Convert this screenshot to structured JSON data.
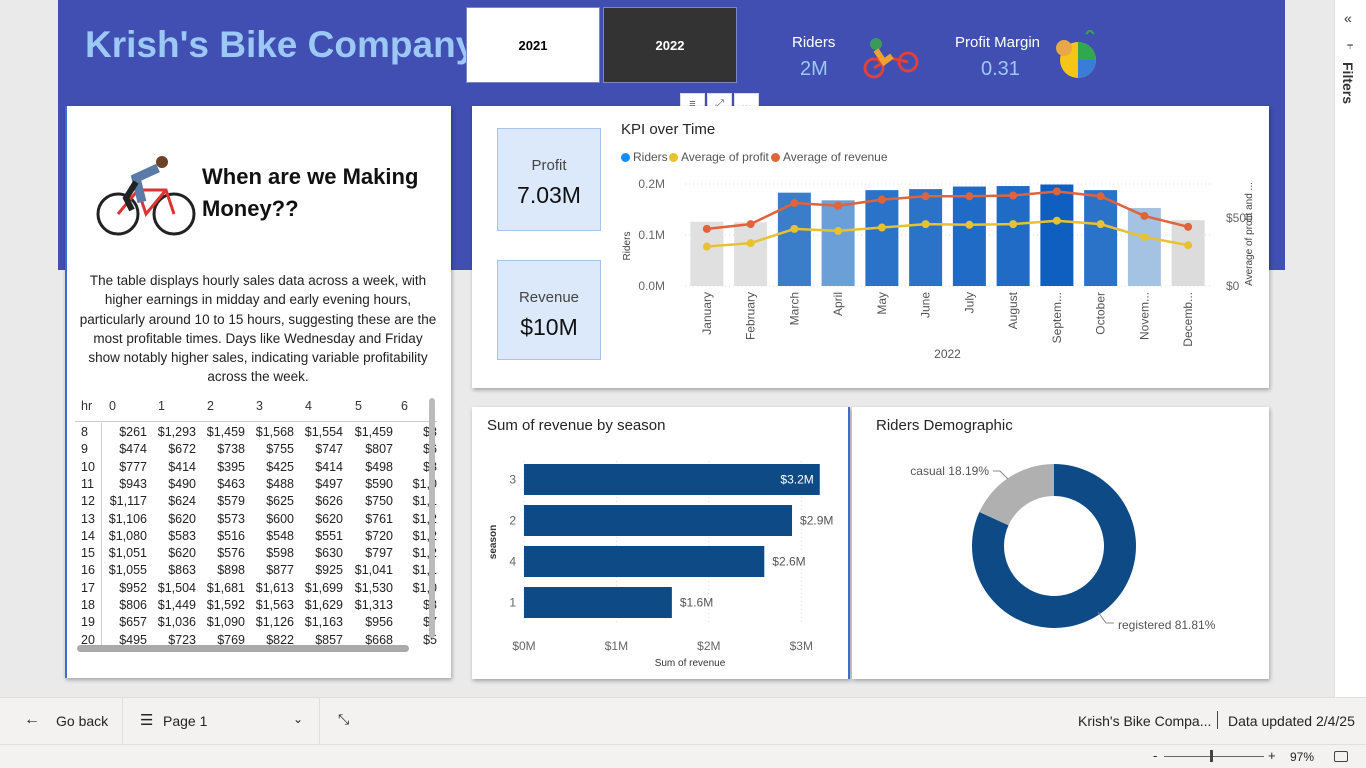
{
  "header": {
    "title": "Krish's Bike Company",
    "year_buttons": [
      {
        "label": "2021"
      },
      {
        "label": "2022"
      }
    ],
    "riders_label": "Riders",
    "riders_value": "2M",
    "margin_label": "Profit Margin",
    "margin_value": "0.31"
  },
  "left_panel": {
    "heading": "When are we Making Money??",
    "description": "The table displays hourly sales data across a week, with higher earnings in midday and early evening hours, particularly around 10 to 15 hours, suggesting these are the most profitable times. Days like Wednesday and Friday show notably higher sales, indicating variable profitability across the week.",
    "matrix": {
      "row_header": "hr",
      "columns": [
        "0",
        "1",
        "2",
        "3",
        "4",
        "5",
        "6"
      ],
      "rows": [
        {
          "hr": "8",
          "cells": [
            "$261",
            "$1,293",
            "$1,459",
            "$1,568",
            "$1,554",
            "$1,459",
            "$3"
          ]
        },
        {
          "hr": "9",
          "cells": [
            "$474",
            "$672",
            "$738",
            "$755",
            "$747",
            "$807",
            "$6"
          ]
        },
        {
          "hr": "10",
          "cells": [
            "$777",
            "$414",
            "$395",
            "$425",
            "$414",
            "$498",
            "$8"
          ]
        },
        {
          "hr": "11",
          "cells": [
            "$943",
            "$490",
            "$463",
            "$488",
            "$497",
            "$590",
            "$1,0"
          ]
        },
        {
          "hr": "12",
          "cells": [
            "$1,117",
            "$624",
            "$579",
            "$625",
            "$626",
            "$750",
            "$1,1"
          ]
        },
        {
          "hr": "13",
          "cells": [
            "$1,106",
            "$620",
            "$573",
            "$600",
            "$620",
            "$761",
            "$1,2"
          ]
        },
        {
          "hr": "14",
          "cells": [
            "$1,080",
            "$583",
            "$516",
            "$548",
            "$551",
            "$720",
            "$1,2"
          ]
        },
        {
          "hr": "15",
          "cells": [
            "$1,051",
            "$620",
            "$576",
            "$598",
            "$630",
            "$797",
            "$1,2"
          ]
        },
        {
          "hr": "16",
          "cells": [
            "$1,055",
            "$863",
            "$898",
            "$877",
            "$925",
            "$1,041",
            "$1,1"
          ]
        },
        {
          "hr": "17",
          "cells": [
            "$952",
            "$1,504",
            "$1,681",
            "$1,613",
            "$1,699",
            "$1,530",
            "$1,0"
          ]
        },
        {
          "hr": "18",
          "cells": [
            "$806",
            "$1,449",
            "$1,592",
            "$1,563",
            "$1,629",
            "$1,313",
            "$8"
          ]
        },
        {
          "hr": "19",
          "cells": [
            "$657",
            "$1,036",
            "$1,090",
            "$1,126",
            "$1,163",
            "$956",
            "$7"
          ]
        },
        {
          "hr": "20",
          "cells": [
            "$495",
            "$723",
            "$769",
            "$822",
            "$857",
            "$668",
            "$5"
          ]
        }
      ]
    }
  },
  "kpi_cards": {
    "profit_label": "Profit",
    "profit_value": "7.03M",
    "revenue_label": "Revenue",
    "revenue_value": "$10M"
  },
  "visual_header_icons": [
    "filter-icon",
    "focus-mode-icon",
    "more-options-icon"
  ],
  "chart_data": [
    {
      "type": "bar",
      "title": "KPI over Time",
      "xlabel": "2022",
      "ylabel": "Riders",
      "y2label": "Average of profit and ...",
      "categories": [
        "January",
        "February",
        "March",
        "April",
        "May",
        "June",
        "July",
        "August",
        "Septem...",
        "October",
        "Novem...",
        "Decemb..."
      ],
      "y_ticks": [
        "0.0M",
        "0.1M",
        "0.2M"
      ],
      "y2_ticks": [
        "$0",
        "$500"
      ],
      "ylim": [
        0,
        0.2
      ],
      "y2lim": [
        0,
        750
      ],
      "series": [
        {
          "name": "Riders",
          "type": "bar",
          "values": [
            0.126,
            0.125,
            0.183,
            0.168,
            0.188,
            0.19,
            0.195,
            0.196,
            0.199,
            0.188,
            0.153,
            0.129
          ]
        },
        {
          "name": "Average of profit",
          "type": "line",
          "values": [
            290,
            315,
            420,
            405,
            430,
            455,
            450,
            455,
            480,
            455,
            360,
            300
          ]
        },
        {
          "name": "Average of revenue",
          "type": "line",
          "values": [
            420,
            455,
            610,
            590,
            635,
            660,
            660,
            665,
            695,
            660,
            515,
            435
          ]
        }
      ],
      "bar_colors": [
        "#e0e0e0",
        "#e0e0e0",
        "#3a7dc9",
        "#6a9fd8",
        "#2a73c9",
        "#2a73c9",
        "#1f6bc6",
        "#1f6bc6",
        "#0f5fc0",
        "#2a73c9",
        "#a4c2e2",
        "#dcdcdc"
      ],
      "colors": {
        "Riders": "#118dff",
        "Average of profit": "#e8c131",
        "Average of revenue": "#e0633a"
      }
    },
    {
      "type": "bar",
      "title": "Sum of revenue by season",
      "xlabel": "Sum of revenue",
      "ylabel": "season",
      "categories": [
        "3",
        "2",
        "4",
        "1"
      ],
      "values": [
        3.2,
        2.9,
        2.6,
        1.6
      ],
      "data_labels": [
        "$3.2M",
        "$2.9M",
        "$2.6M",
        "$1.6M"
      ],
      "x_ticks": [
        "$0M",
        "$1M",
        "$2M",
        "$3M"
      ],
      "xlim": [
        0,
        3.3
      ],
      "color": "#0e4a86"
    },
    {
      "type": "pie",
      "title": "Riders Demographic",
      "categories": [
        "registered",
        "casual"
      ],
      "values": [
        81.81,
        18.19
      ],
      "data_labels": [
        "registered 81.81%",
        "casual 18.19%"
      ],
      "colors": [
        "#0e4a86",
        "#b0b0b0"
      ]
    }
  ],
  "bottom_bar": {
    "go_back": "Go back",
    "page_label": "Page 1",
    "report_name": "Krish's Bike Compa...",
    "data_updated": "Data updated 2/4/25",
    "zoom": "97%"
  },
  "filters_pane": {
    "label": "Filters"
  }
}
